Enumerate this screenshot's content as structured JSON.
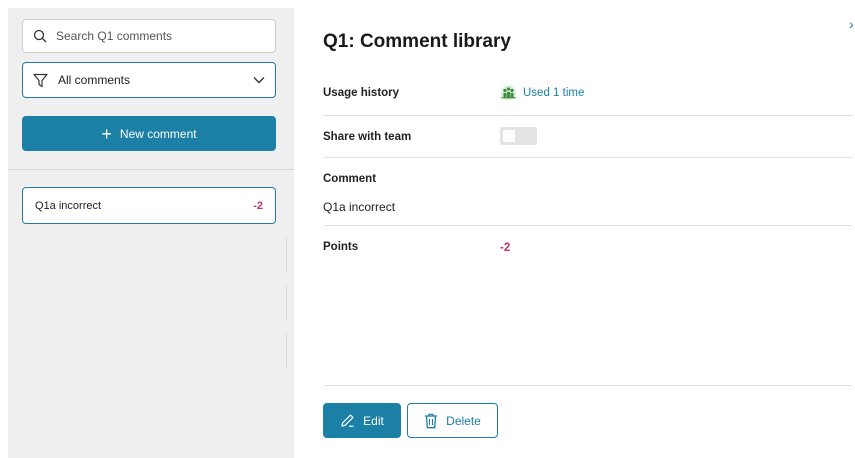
{
  "sidebar": {
    "search": {
      "placeholder": "Search Q1 comments",
      "value": ""
    },
    "filter": {
      "selected": "All comments"
    },
    "new_comment_label": "New comment",
    "comments": [
      {
        "label": "Q1a incorrect",
        "points": "-2"
      }
    ]
  },
  "detail": {
    "title": "Q1: Comment library",
    "usage_history_label": "Usage history",
    "usage_history_value": "Used 1 time",
    "share_label": "Share with team",
    "share_enabled": false,
    "comment_label": "Comment",
    "comment_text": "Q1a incorrect",
    "points_label": "Points",
    "points_value": "-2",
    "edit_label": "Edit",
    "delete_label": "Delete"
  },
  "icons": {
    "search": "search-icon",
    "filter": "filter-icon",
    "chevron": "chevron-down-icon",
    "plus": "plus-icon",
    "usage": "team-icon",
    "edit": "pencil-icon",
    "delete": "trash-icon",
    "close": "chevron-right-icon"
  },
  "colors": {
    "accent": "#1b7fa6",
    "points": "#c2306b",
    "sidebar_bg": "#efefef"
  }
}
